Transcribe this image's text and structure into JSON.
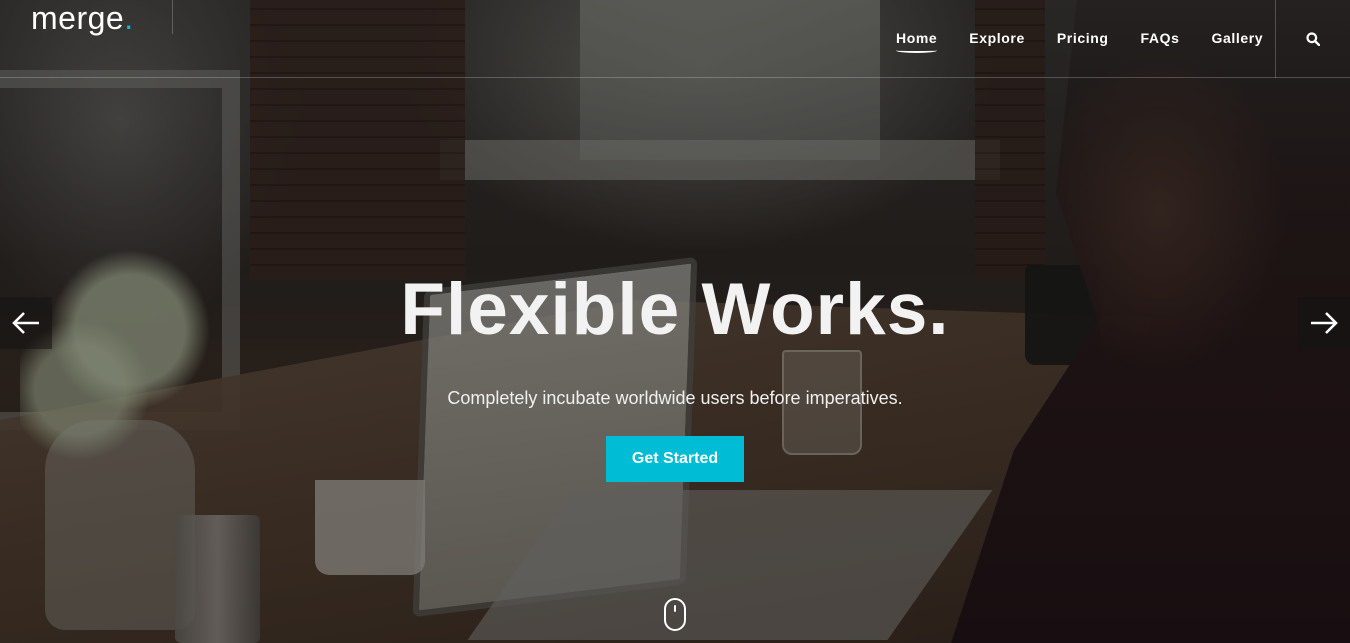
{
  "brand": {
    "name": "merge",
    "dot": "."
  },
  "nav": {
    "items": [
      {
        "label": "Home",
        "active": true
      },
      {
        "label": "Explore",
        "active": false
      },
      {
        "label": "Pricing",
        "active": false
      },
      {
        "label": "FAQs",
        "active": false
      },
      {
        "label": "Gallery",
        "active": false
      }
    ],
    "search_icon": "search-icon"
  },
  "hero": {
    "title": "Flexible Works.",
    "subtitle": "Completely incubate worldwide users before imperatives.",
    "cta_label": "Get Started"
  },
  "slider": {
    "prev_icon": "arrow-left-icon",
    "next_icon": "arrow-right-icon"
  },
  "scroll_icon": "mouse-scroll-icon",
  "colors": {
    "accent": "#00bcd4",
    "logo_dot": "#19b7d3",
    "text": "#ffffff"
  }
}
